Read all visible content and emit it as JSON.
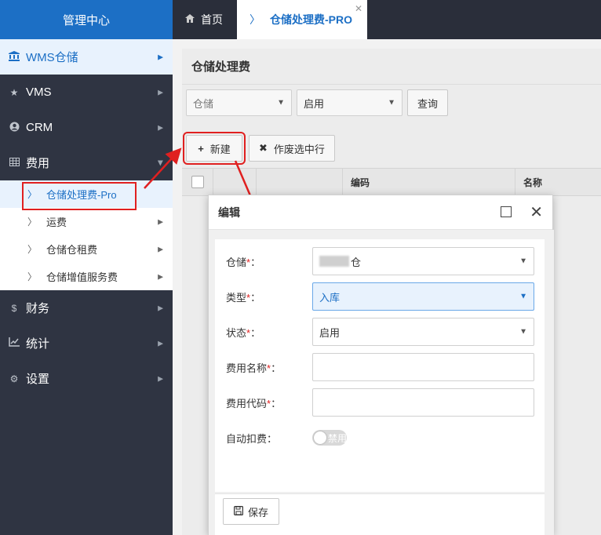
{
  "sidebar": {
    "brand": "管理中心",
    "items": [
      {
        "label": "WMS仓储",
        "icon": "bank-icon"
      },
      {
        "label": "VMS",
        "icon": "star-icon"
      },
      {
        "label": "CRM",
        "icon": "user-circle-icon"
      },
      {
        "label": "费用",
        "icon": "table-icon"
      },
      {
        "label": "财务",
        "icon": "dollar-icon"
      },
      {
        "label": "统计",
        "icon": "line-chart-icon"
      },
      {
        "label": "设置",
        "icon": "gear-icon"
      }
    ],
    "sub_items": [
      {
        "label": "仓储处理费-Pro"
      },
      {
        "label": "运费"
      },
      {
        "label": "仓储仓租费"
      },
      {
        "label": "仓储增值服务费"
      }
    ]
  },
  "tabs": {
    "home": "首页",
    "current": "仓储处理费-PRO"
  },
  "page": {
    "title": "仓储处理费",
    "filter_warehouse": "仓储",
    "filter_status": "启用",
    "query_button": "查询",
    "new_button": "新建",
    "void_button": "作废选中行",
    "columns": [
      "编码",
      "名称"
    ]
  },
  "modal": {
    "title": "编辑",
    "fields": {
      "warehouse_label": "仓储",
      "warehouse_value": "仓",
      "type_label": "类型",
      "type_value": "入库",
      "status_label": "状态",
      "status_value": "启用",
      "fee_name_label": "费用名称",
      "fee_code_label": "费用代码",
      "auto_deduct_label": "自动扣费",
      "auto_deduct_value": "禁用"
    },
    "required_mark": "*",
    "colon": "：",
    "save_button": "保存"
  },
  "colors": {
    "accent": "#1c6fc5",
    "sidebar_bg": "#2f3442",
    "highlight": "#e02020"
  }
}
